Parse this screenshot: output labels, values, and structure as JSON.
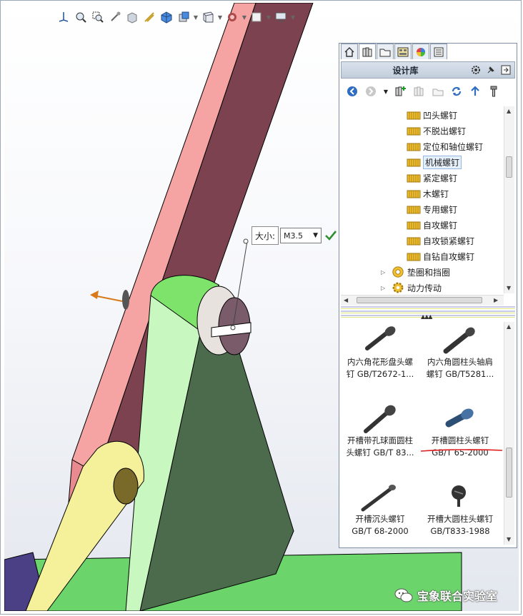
{
  "toolbar": {
    "icons": [
      "view-orientation-icon",
      "zoom-to-fit-icon",
      "zoom-to-area-icon",
      "previous-view-icon",
      "section-view-icon",
      "view-settings-icon",
      "display-style-icon",
      "hide-show-icon",
      "edit-appearance-icon",
      "apply-scene-icon",
      "view-settings-icon",
      "display-icon"
    ]
  },
  "size_popup": {
    "label": "大小:",
    "value": "M3.5",
    "confirm_icon": "checkmark-icon"
  },
  "task_pane": {
    "tabs": [
      "home-icon",
      "design-library-icon",
      "file-explorer-icon",
      "view-palette-icon",
      "appearances-icon",
      "custom-properties-icon"
    ],
    "active_tab": 1,
    "title": "设计库",
    "header_icons": [
      "options-icon",
      "pin-icon",
      "collapse-icon"
    ],
    "nav_icons": [
      "back-icon",
      "forward-icon",
      "add-to-library-icon",
      "add-file-location-icon",
      "create-new-folder-icon",
      "refresh-icon",
      "up-one-level-icon",
      "toolbox-icon"
    ],
    "tree": [
      {
        "label": "凹头螺钉",
        "type": "folder"
      },
      {
        "label": "不脱出螺钉",
        "type": "folder"
      },
      {
        "label": "定位和轴位螺钉",
        "type": "folder"
      },
      {
        "label": "机械螺钉",
        "type": "folder",
        "selected": true
      },
      {
        "label": "紧定螺钉",
        "type": "folder"
      },
      {
        "label": "木螺钉",
        "type": "folder"
      },
      {
        "label": "专用螺钉",
        "type": "folder"
      },
      {
        "label": "自攻螺钉",
        "type": "folder"
      },
      {
        "label": "自攻锁紧螺钉",
        "type": "folder"
      },
      {
        "label": "自钻自攻螺钉",
        "type": "folder"
      },
      {
        "label": "垫圈和挡圈",
        "type": "category",
        "icon": "washer-icon"
      },
      {
        "label": "动力传动",
        "type": "category",
        "icon": "gear-icon"
      }
    ],
    "items": [
      {
        "line1": "内六角花形盘头螺",
        "line2": "钉 GB/T2672-1...",
        "icon": "socket-pan-head-screw-icon"
      },
      {
        "line1": "内六角圆柱头轴肩",
        "line2": "螺钉 GB/T5281...",
        "icon": "shoulder-screw-icon"
      },
      {
        "line1": "开槽带孔球面圆柱",
        "line2": "头螺钉 GB/T 83...",
        "icon": "slotted-cheese-head-screw-icon"
      },
      {
        "line1": "开槽圆柱头螺钉",
        "line2": "GB/T 65-2000",
        "icon": "slotted-cylinder-head-screw-icon",
        "highlighted": true
      },
      {
        "line1": "开槽沉头螺钉",
        "line2": "GB/T 68-2000",
        "icon": "countersunk-screw-icon"
      },
      {
        "line1": "开槽大圆柱头螺钉",
        "line2": "GB/T833-1988",
        "icon": "large-cheese-head-screw-icon"
      }
    ]
  },
  "watermark": {
    "text": "宝象联合实验室",
    "icon": "wechat-icon"
  },
  "colors": {
    "arm_front": "#f5a3a3",
    "arm_side": "#7c4250",
    "block_green": "#7de36a",
    "block_dark": "#4c6b4c",
    "yellow_link": "#f5f09a",
    "base": "#6bd56b",
    "accent_check": "#2f8f2f",
    "highlight_line": "#e02020"
  }
}
